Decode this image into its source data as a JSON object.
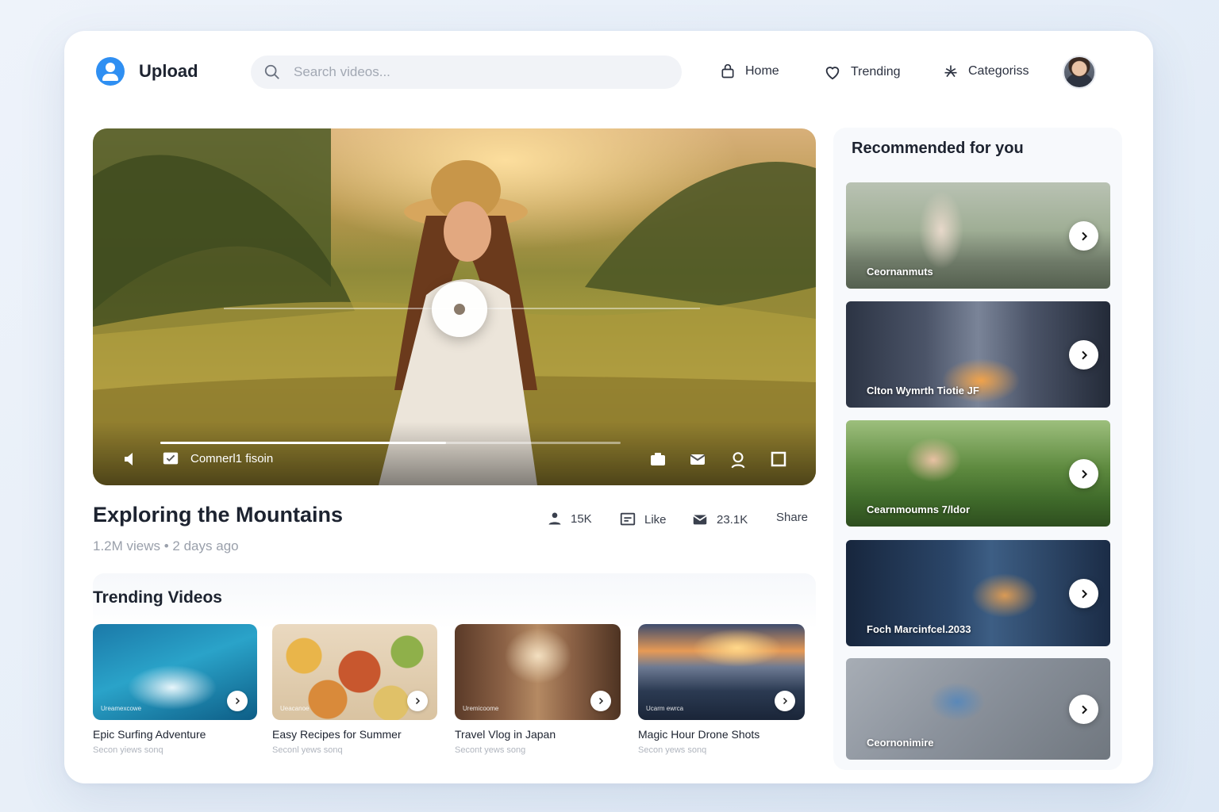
{
  "header": {
    "logo_label": "Upload",
    "search_placeholder": "Search videos...",
    "nav": [
      {
        "label": "Home",
        "icon": "bag-icon"
      },
      {
        "label": "Trending",
        "icon": "heart-icon"
      },
      {
        "label": "Categoriss",
        "icon": "sparkle-icon"
      }
    ]
  },
  "player": {
    "control_label": "Comnerl1 fisoin",
    "progress_fraction": 0.62
  },
  "video": {
    "title": "Exploring the Mountains",
    "meta": "1.2M views • 2 days ago",
    "actions": [
      {
        "label": "15K",
        "icon": "user-icon"
      },
      {
        "label": "Like",
        "icon": "chat-icon"
      },
      {
        "label": "23.1K",
        "icon": "mail-icon"
      },
      {
        "label": "Share",
        "icon": ""
      }
    ]
  },
  "trending": {
    "title": "Trending Videos",
    "items": [
      {
        "title": "Epic Surfing Adventure",
        "sub": "Secon yiews sonq",
        "thumb_caption": "Ureamexcowe"
      },
      {
        "title": "Easy Recipes for Summer",
        "sub": "Seconl yews sonq",
        "thumb_caption": "Ueacanoe"
      },
      {
        "title": "Travel Vlog in Japan",
        "sub": "Secont yews song",
        "thumb_caption": "Uremicoome"
      },
      {
        "title": "Magic Hour Drone Shots",
        "sub": "Secon yews sonq",
        "thumb_caption": "Ucarm ewrca"
      }
    ]
  },
  "recommended": {
    "title": "Recommended for you",
    "items": [
      {
        "caption": "Ceornanmuts"
      },
      {
        "caption": "Clton Wymrth   Tiotie JF"
      },
      {
        "caption": "Cearnmoumns   7/ldor"
      },
      {
        "caption": "Foch Marcinfcel.2033"
      },
      {
        "caption": "Ceornonimire"
      }
    ]
  },
  "colors": {
    "accent": "#2f8ff2",
    "card_bg": "#ffffff",
    "page_bg": "#eaf0f8"
  }
}
